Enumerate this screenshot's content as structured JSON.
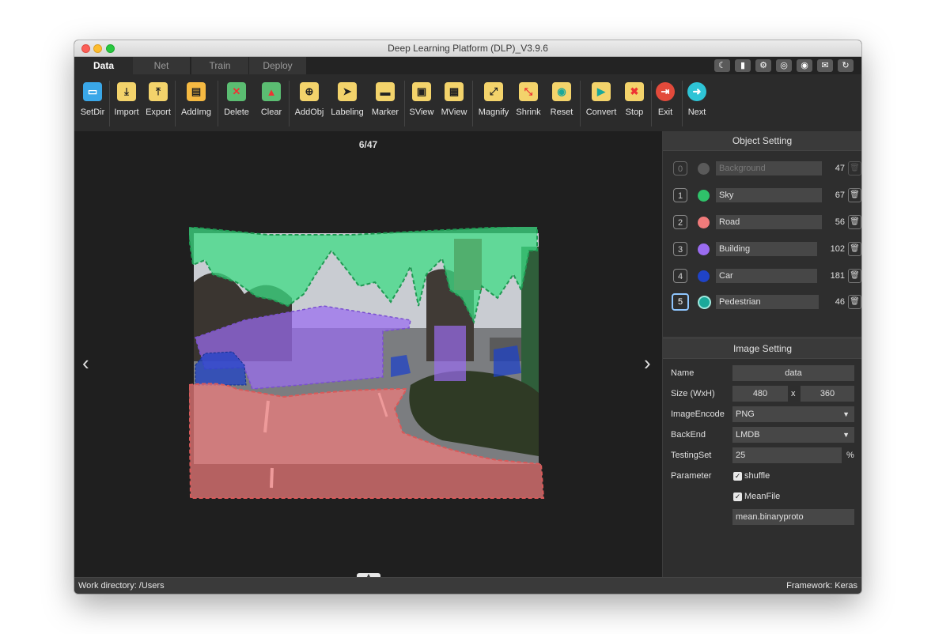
{
  "window": {
    "title": "Deep Learning Platform (DLP)_V3.9.6"
  },
  "tabs": [
    {
      "label": "Data",
      "active": true
    },
    {
      "label": "Net",
      "active": false
    },
    {
      "label": "Train",
      "active": false
    },
    {
      "label": "Deploy",
      "active": false
    }
  ],
  "title_icons": [
    "moon-icon",
    "sd-card-icon",
    "gear-icon",
    "compass-icon",
    "wechat-icon",
    "mail-icon",
    "refresh-icon"
  ],
  "toolbar": [
    {
      "label": "SetDir",
      "icon": "folder-icon",
      "color": "#3aa7e8"
    },
    {
      "label": "Import",
      "icon": "import-icon",
      "color": "#f3d36b"
    },
    {
      "label": "Export",
      "icon": "export-icon",
      "color": "#f3d36b"
    },
    {
      "label": "AddImg",
      "icon": "add-image-icon",
      "color": "#f5b942"
    },
    {
      "label": "Delete",
      "icon": "delete-image-icon",
      "color": "#5bbd72"
    },
    {
      "label": "Clear",
      "icon": "clear-icon",
      "color": "#5bbd72"
    },
    {
      "label": "AddObj",
      "icon": "add-object-icon",
      "color": "#f3d36b"
    },
    {
      "label": "Labeling",
      "icon": "labeling-icon",
      "color": "#f3d36b"
    },
    {
      "label": "Marker",
      "icon": "marker-icon",
      "color": "#f3d36b"
    },
    {
      "label": "SView",
      "icon": "single-view-icon",
      "color": "#f3d36b"
    },
    {
      "label": "MView",
      "icon": "multi-view-icon",
      "color": "#f3d36b"
    },
    {
      "label": "Magnify",
      "icon": "magnify-icon",
      "color": "#f3d36b"
    },
    {
      "label": "Shrink",
      "icon": "shrink-icon",
      "color": "#f3d36b"
    },
    {
      "label": "Reset",
      "icon": "reset-icon",
      "color": "#f3d36b"
    },
    {
      "label": "Convert",
      "icon": "play-icon",
      "color": "#f3d36b"
    },
    {
      "label": "Stop",
      "icon": "stop-icon",
      "color": "#f3d36b"
    },
    {
      "label": "Exit",
      "icon": "exit-icon",
      "color": "#e24a3b"
    },
    {
      "label": "Next",
      "icon": "next-arrow-icon",
      "color": "#2ec4d6"
    }
  ],
  "canvas": {
    "counter": "6/47"
  },
  "object_setting": {
    "title": "Object Setting",
    "objects": [
      {
        "index": "0",
        "name": "Background",
        "count": "47",
        "color": "#5a5a5a"
      },
      {
        "index": "1",
        "name": "Sky",
        "count": "67",
        "color": "#2fc26a"
      },
      {
        "index": "2",
        "name": "Road",
        "count": "56",
        "color": "#f07b7b"
      },
      {
        "index": "3",
        "name": "Building",
        "count": "102",
        "color": "#9a6cf0"
      },
      {
        "index": "4",
        "name": "Car",
        "count": "181",
        "color": "#1f43c7"
      },
      {
        "index": "5",
        "name": "Pedestrian",
        "count": "46",
        "color": "#1aa89a"
      }
    ]
  },
  "image_setting": {
    "title": "Image Setting",
    "name_label": "Name",
    "name_value": "data",
    "size_label": "Size (WxH)",
    "width": "480",
    "x_sep": "x",
    "height": "360",
    "encode_label": "ImageEncode",
    "encode_value": "PNG",
    "backend_label": "BackEnd",
    "backend_value": "LMDB",
    "testing_label": "TestingSet",
    "testing_value": "25",
    "testing_unit": "%",
    "param_label": "Parameter",
    "shuffle_label": "shuffle",
    "shuffle_checked": true,
    "meanfile_label": "MeanFile",
    "meanfile_checked": true,
    "meanfile_value": "mean.binaryproto"
  },
  "status": {
    "left": "Work directory: /Users",
    "right": "Framework: Keras"
  }
}
